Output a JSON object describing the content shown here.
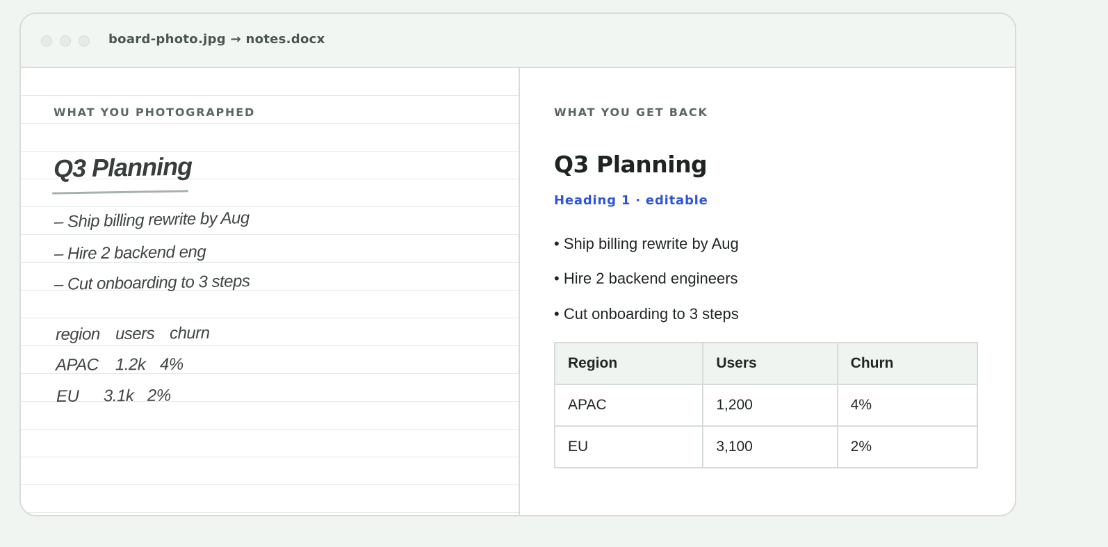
{
  "window": {
    "title": "board-photo.jpg → notes.docx"
  },
  "left": {
    "eyebrow": "WHAT YOU PHOTOGRAPHED",
    "title": "Q3 Planning",
    "lines": [
      "– Ship billing rewrite by Aug",
      "– Hire 2 backend eng",
      "– Cut onboarding to 3 steps"
    ],
    "table": {
      "header": [
        "region",
        "users",
        "churn"
      ],
      "rows": [
        [
          "APAC",
          "1.2k",
          "4%"
        ],
        [
          "EU",
          "3.1k",
          "2%"
        ]
      ]
    }
  },
  "right": {
    "eyebrow": "WHAT YOU GET BACK",
    "title": "Q3 Planning",
    "tag": "Heading 1 · editable",
    "bullets": [
      "• Ship billing rewrite by Aug",
      "• Hire 2 backend engineers",
      "• Cut onboarding to 3 steps"
    ],
    "table": {
      "columns": [
        "Region",
        "Users",
        "Churn"
      ],
      "rows": [
        [
          "APAC",
          "1,200",
          "4%"
        ],
        [
          "EU",
          "3,100",
          "2%"
        ]
      ]
    }
  },
  "colors": {
    "background": "#f1f5f1",
    "accent": "#2f55d4",
    "border": "#d6ddd8"
  }
}
